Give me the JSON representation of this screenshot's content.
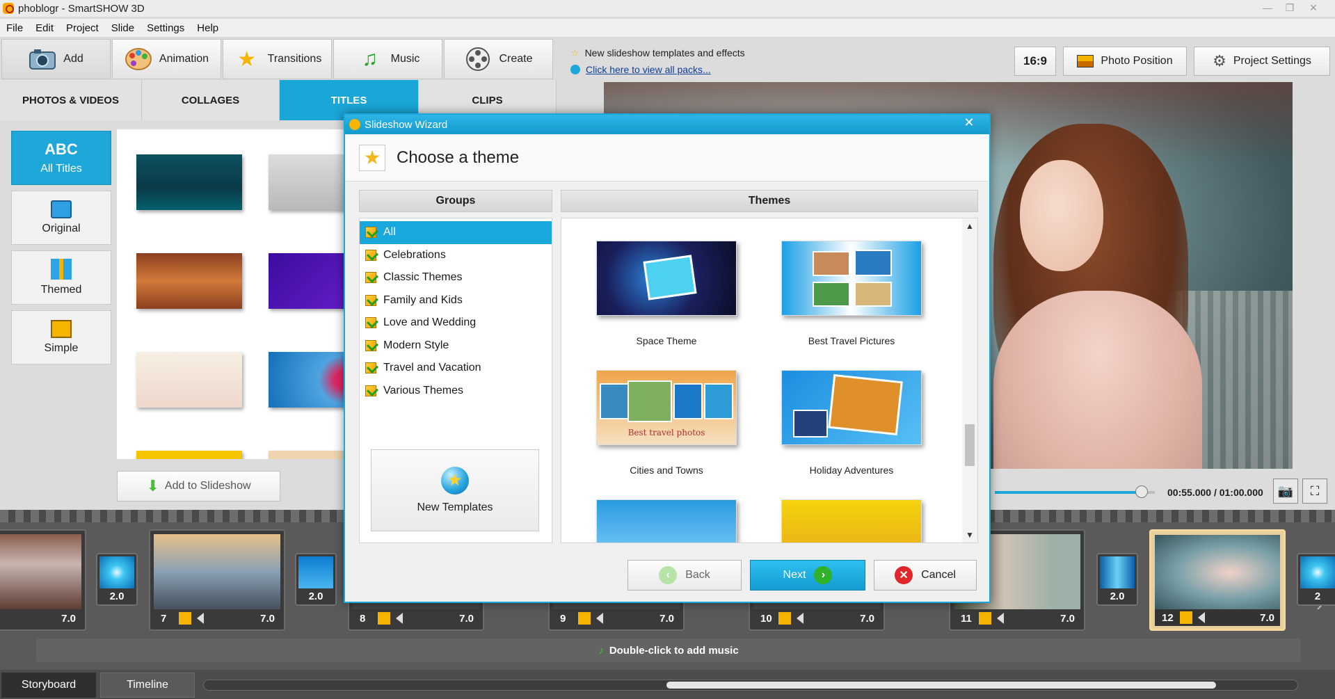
{
  "window": {
    "title": "phoblogr - SmartSHOW 3D"
  },
  "menu": [
    "File",
    "Edit",
    "Project",
    "Slide",
    "Settings",
    "Help"
  ],
  "main_tabs": [
    {
      "label": "Add",
      "icon": "camera-icon"
    },
    {
      "label": "Animation",
      "icon": "palette-icon"
    },
    {
      "label": "Transitions",
      "icon": "star-icon"
    },
    {
      "label": "Music",
      "icon": "music-note-icon"
    },
    {
      "label": "Create",
      "icon": "film-reel-icon"
    }
  ],
  "sub_tabs": [
    "PHOTOS & VIDEOS",
    "COLLAGES",
    "TITLES",
    "CLIPS"
  ],
  "title_categories": [
    {
      "label": "All Titles",
      "icon_text": "ABC"
    },
    {
      "label": "Original",
      "icon": "monitor-icon"
    },
    {
      "label": "Themed",
      "icon": "gift-icon"
    },
    {
      "label": "Simple",
      "icon": "abc-box-icon"
    }
  ],
  "add_to_slideshow": "Add to Slideshow",
  "news": {
    "line1": "New slideshow templates and effects",
    "line2": "Click here to view all packs..."
  },
  "toolbar": {
    "ratio": "16:9",
    "photo_position": "Photo Position",
    "project_settings": "Project Settings"
  },
  "player": {
    "time": "00:55.000 / 01:00.000",
    "progress": 0.917
  },
  "dialog": {
    "window_title": "Slideshow Wizard",
    "heading": "Choose a theme",
    "groups_header": "Groups",
    "themes_header": "Themes",
    "groups": [
      "All",
      "Celebrations",
      "Classic Themes",
      "Family and Kids",
      "Love and Wedding",
      "Modern Style",
      "Travel and Vacation",
      "Various Themes"
    ],
    "new_templates": "New Templates",
    "themes": [
      "Space Theme",
      "Best Travel Pictures",
      "Cities and Towns",
      "Holiday Adventures"
    ],
    "theme_thumb_caption": "Best travel photos",
    "back": "Back",
    "next": "Next",
    "cancel": "Cancel"
  },
  "storyboard": {
    "slides": [
      {
        "num": "",
        "duration": "7.0"
      },
      {
        "num": "7",
        "duration": "7.0"
      },
      {
        "num": "8",
        "duration": "7.0"
      },
      {
        "num": "9",
        "duration": "7.0"
      },
      {
        "num": "10",
        "duration": "7.0"
      },
      {
        "num": "11",
        "duration": "7.0"
      },
      {
        "num": "12",
        "duration": "7.0"
      }
    ],
    "transitions": [
      "2.0",
      "2.0",
      "2.0",
      "2"
    ],
    "music_hint": "Double-click to add music"
  },
  "bottom_tabs": [
    "Storyboard",
    "Timeline"
  ],
  "colors": {
    "accent": "#1aa6d6",
    "selected_slide": "#f3d79b"
  }
}
